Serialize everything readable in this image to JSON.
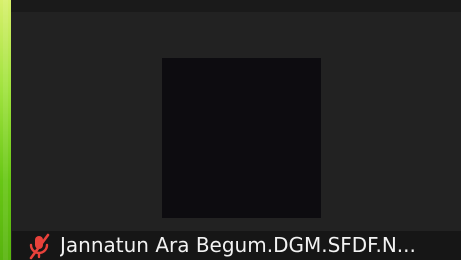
{
  "participant": {
    "name": "Jannatun Ara Begum.DGM.SFDF.N...",
    "mic_status_icon": "mic-muted-icon",
    "active_speaker": true
  },
  "colors": {
    "speaker_border": "#7ccf1f",
    "mic_muted": "#e8423b",
    "tile_background": "#222222",
    "avatar_background": "#0d0c10",
    "name_text": "#f2f2f2"
  }
}
